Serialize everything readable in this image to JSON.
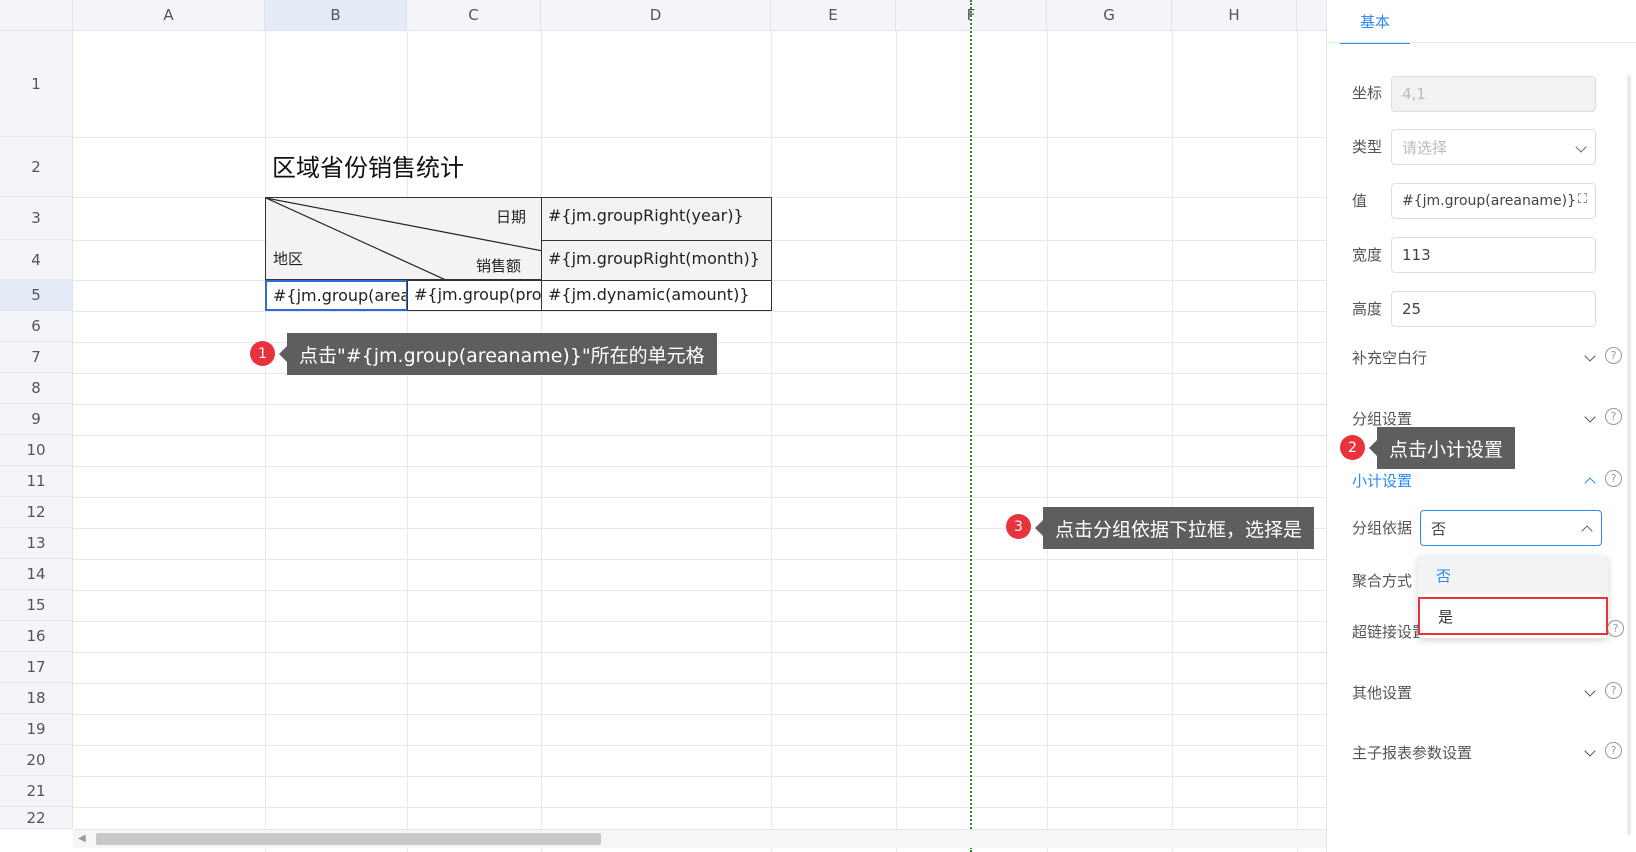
{
  "columns": [
    "A",
    "B",
    "C",
    "D",
    "E",
    "F",
    "G",
    "H"
  ],
  "rows": [
    "1",
    "2",
    "3",
    "4",
    "5",
    "6",
    "7",
    "8",
    "9",
    "10",
    "11",
    "12",
    "13",
    "14",
    "15",
    "16",
    "17",
    "18",
    "19",
    "20",
    "21",
    "22"
  ],
  "sheet": {
    "title": "区域省份销售统计",
    "header_date": "日期",
    "header_region": "地区",
    "header_sales": "销售额",
    "cell_d3": "#{jm.groupRight(year)}",
    "cell_d4": "#{jm.groupRight(month)}",
    "cell_b5": "#{jm.group(area",
    "cell_c5": "#{jm.group(pro",
    "cell_d5": "#{jm.dynamic(amount)}"
  },
  "annotations": [
    {
      "num": "1",
      "text": "点击\"#{jm.group(areaname)}\"所在的单元格"
    },
    {
      "num": "2",
      "text": "点击小计设置"
    },
    {
      "num": "3",
      "text": "点击分组依据下拉框，选择是"
    }
  ],
  "panel": {
    "tab": "基本",
    "coord_label": "坐标",
    "coord_value": "4,1",
    "type_label": "类型",
    "type_placeholder": "请选择",
    "value_label": "值",
    "value_value": "#{jm.group(areaname)}",
    "width_label": "宽度",
    "width_value": "113",
    "height_label": "高度",
    "height_value": "25",
    "sections": {
      "fill_blank": "补充空白行",
      "group": "分组设置",
      "subtotal": "小计设置",
      "group_basis": "分组依据",
      "group_basis_value": "否",
      "aggregate": "聚合方式",
      "hyperlink": "超链接设置",
      "other": "其他设置",
      "subreport": "主子报表参数设置"
    },
    "dropdown_options": [
      "否",
      "是"
    ]
  },
  "colors": {
    "accent": "#2d8cf0",
    "annotation_red": "#e8323c",
    "annotation_bg": "#5e5e5e"
  }
}
